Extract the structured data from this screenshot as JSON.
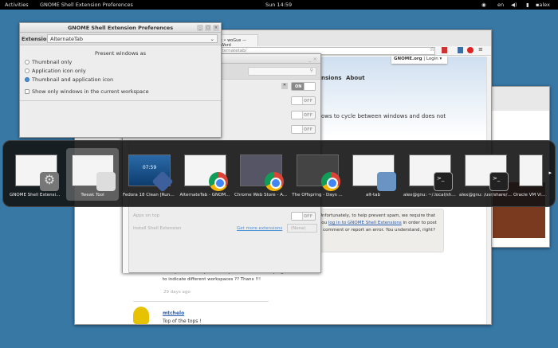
{
  "topbar": {
    "activities": "Activities",
    "app_title": "GNOME Shell Extension Preferences",
    "clock": "Sun 14:59",
    "lang": "en",
    "user": "alex"
  },
  "browser": {
    "tab": "t • woGue — Word",
    "url": "lternatetab/",
    "gnome_org": "GNOME.org",
    "login": "Login ▾",
    "nav": [
      "nsions",
      "About"
    ],
    "desc": "ows to cycle between windows and does not",
    "notice": "Unfortunately, to help prevent spam, we require that you",
    "notice_link": "log in to GNOME Shell Extensions",
    "notice_rest": "in order to post a comment or report an error. You understand, right?",
    "comment1": "example : can a separator be placed between the programs to indicate different workspaces ?? Thanx !!!",
    "comment1_time": "29 days ago",
    "comment2_author": "mtchelo",
    "comment2_text": "Top of the tops !"
  },
  "tweak": {
    "rows": [
      {
        "state": "ON"
      },
      {
        "state": "OFF"
      },
      {
        "state": "OFF"
      },
      {
        "state": "OFF"
      }
    ],
    "apps_on_top": "Apps on top",
    "apps_on_top_state": "OFF",
    "install": "Install Shell Extension",
    "get_more": "Get more extensions",
    "none": "(None)"
  },
  "prefs": {
    "title": "GNOME Shell Extension Preferences",
    "extension_label": "Extension",
    "extension_value": "AlternateTab",
    "heading": "Present windows as",
    "options": [
      "Thumbnail only",
      "Application icon only",
      "Thumbnail and application icon"
    ],
    "selected": 2,
    "checkbox": "Show only windows in the current workspace",
    "checked": false
  },
  "switcher": {
    "items": [
      "GNOME Shell Extensio...",
      "Tweak Tool",
      "Fedora 18 Clean [Runni...",
      "AlternateTab - GNOM...",
      "Chrome Web Store - A...",
      "The Offspring - Days ...",
      "alt-tab",
      "alex@gnu: ~/.local/shar...",
      "alex@gnu: /usr/share/g...",
      "Oracle VM Vir..."
    ],
    "selected": 1
  }
}
